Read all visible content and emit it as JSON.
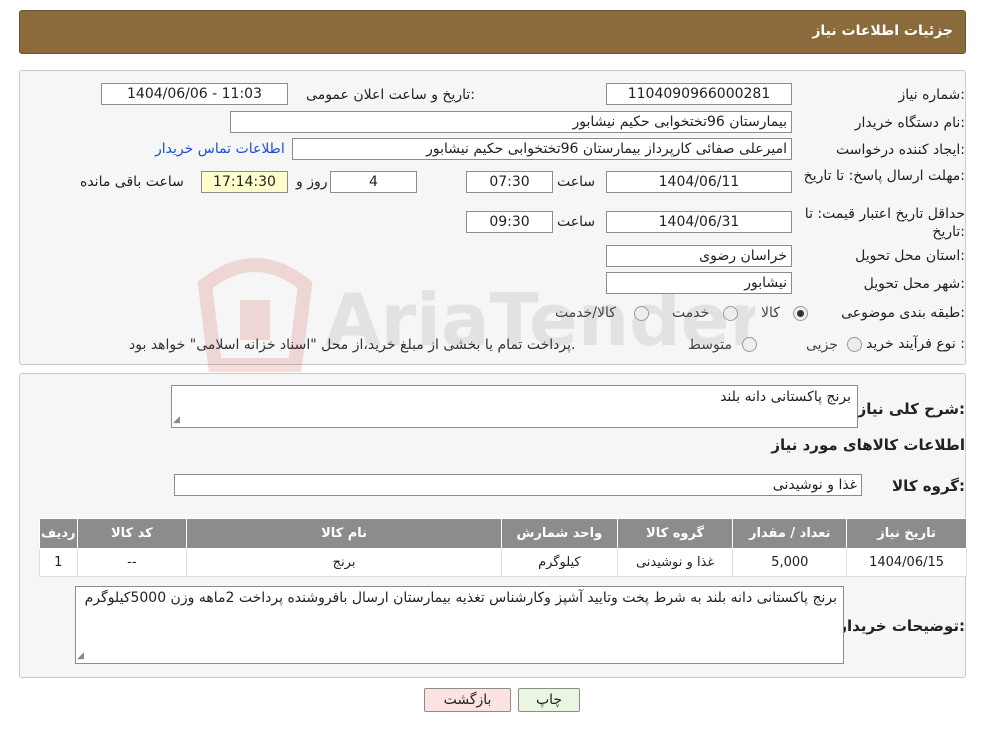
{
  "header": {
    "title": "جزئیات اطلاعات نیاز"
  },
  "form": {
    "need_number": {
      "label": "شماره نیاز:",
      "value": "1104090966000281"
    },
    "announce_datetime": {
      "label": "تاریخ و ساعت اعلان عمومی:",
      "value": "1404/06/06 - 11:03"
    },
    "buyer_org": {
      "label": "نام دستگاه خریدار:",
      "value": "بیمارستان 96تختخوابی حکیم نیشابور"
    },
    "requester": {
      "label": "ایجاد کننده درخواست:",
      "value": "امیرعلی صفائی کارپرداز بیمارستان 96تختخوابی حکیم نیشابور"
    },
    "contact_link": "اطلاعات تماس خریدار",
    "deadline": {
      "label": "مهلت ارسال پاسخ: تا تاریخ:",
      "date": "1404/06/11",
      "time_label": "ساعت",
      "time": "07:30",
      "days": "4",
      "days_label": "روز و",
      "remaining": "17:14:30",
      "remaining_label": "ساعت باقی مانده"
    },
    "validity": {
      "label": "حداقل تاریخ اعتبار قیمت: تا تاریخ:",
      "date": "1404/06/31",
      "time_label": "ساعت",
      "time": "09:30"
    },
    "province": {
      "label": "استان محل تحویل:",
      "value": "خراسان رضوی"
    },
    "city": {
      "label": "شهر محل تحویل:",
      "value": "نیشابور"
    },
    "category": {
      "label": "طبقه بندی موضوعی:",
      "options": [
        "کالا",
        "خدمت",
        "کالا/خدمت"
      ],
      "selected": "کالا"
    },
    "process": {
      "label": "نوع فرآیند خرید :",
      "options": [
        "جزیی",
        "متوسط"
      ],
      "note": "پرداخت تمام یا بخشی از مبلغ خرید،از محل \"اسناد خزانه اسلامی\" خواهد بود."
    }
  },
  "watermark": {
    "text": "AriaTender.neT"
  },
  "details": {
    "summary_label": "شرح کلی نیاز:",
    "summary_value": "برنج پاکستانی دانه بلند",
    "goods_title": "اطلاعات کالاهای مورد نیاز",
    "group_label": "گروه کالا:",
    "group_value": "غذا و نوشیدنی",
    "table": {
      "headers": [
        "ردیف",
        "کد کالا",
        "نام کالا",
        "واحد شمارش",
        "گروه کالا",
        "تعداد / مقدار",
        "تاریخ نیاز"
      ],
      "rows": [
        [
          "1",
          "--",
          "برنج",
          "کیلوگرم",
          "غذا و نوشیدنی",
          "5,000",
          "1404/06/15"
        ]
      ]
    },
    "buyer_notes_label": "توضیحات خریدار:",
    "buyer_notes_value": "برنج پاکستانی دانه بلند به شرط پخت وتایید آشپز وکارشناس تغذیه بیمارستان ارسال بافروشنده پرداخت 2ماهه وزن 5000کیلوگرم"
  },
  "buttons": {
    "print": "چاپ",
    "back": "بازگشت"
  },
  "colors": {
    "header": "#8b6a3c",
    "table_header": "#8c8c8c",
    "back_button": "#fde2e2",
    "print_button": "#e9f7e2",
    "link": "#1a4fd6"
  }
}
